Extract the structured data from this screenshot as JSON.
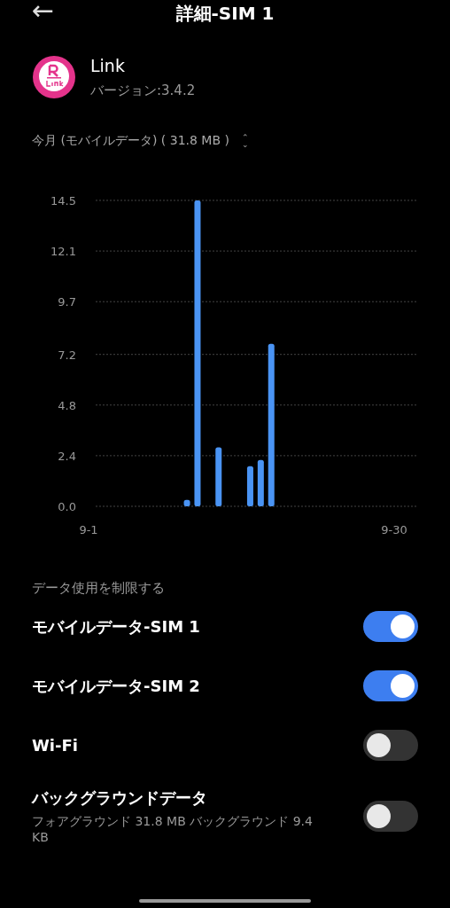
{
  "header": {
    "back_icon": "←",
    "title": "詳細-SIM 1"
  },
  "app": {
    "name": "Link",
    "version": "バージョン:3.4.2"
  },
  "usage_period": {
    "label": "今月 (モバイルデータ) ( 31.8 MB )",
    "icon": "⌃⌄"
  },
  "usage_chart": {
    "chart_data": {
      "type": "bar",
      "categories": [
        "9-1",
        null,
        null,
        null,
        null,
        null,
        null,
        null,
        null,
        null,
        null,
        null,
        null,
        null,
        null,
        null,
        null,
        null,
        null,
        null,
        null,
        null,
        null,
        null,
        null,
        null,
        null,
        null,
        null,
        "9-30"
      ],
      "values": [
        null,
        null,
        null,
        null,
        null,
        null,
        null,
        null,
        null,
        0.3,
        14.5,
        null,
        2.8,
        null,
        null,
        1.9,
        2.2,
        7.7,
        null,
        null,
        null,
        null,
        null,
        null,
        null,
        null,
        null,
        null,
        null,
        null
      ],
      "ylim": [
        0,
        14.5
      ],
      "grid": true,
      "yticks": [
        {
          "value": 0,
          "label": "0.0"
        },
        {
          "value": 2.4,
          "label": "2.4"
        },
        {
          "value": 4.8,
          "label": "4.8"
        },
        {
          "value": 7.2,
          "label": "7.2"
        },
        {
          "value": 9.7,
          "label": "9.7"
        },
        {
          "value": 12.1,
          "label": "12.1"
        },
        {
          "value": 14.5,
          "label": "14.5"
        }
      ]
    }
  },
  "restrict_section": {
    "title": "データ使用を制限する",
    "items": [
      {
        "label": "モバイルデータ-SIM 1",
        "on": true
      },
      {
        "label": "モバイルデータ-SIM 2",
        "on": true
      },
      {
        "label": "Wi-Fi",
        "on": false
      },
      {
        "label": "バックグラウンドデータ",
        "subtitle": "フォアグラウンド 31.8 MB  バックグラウンド 9.4 KB",
        "on": false
      }
    ]
  }
}
